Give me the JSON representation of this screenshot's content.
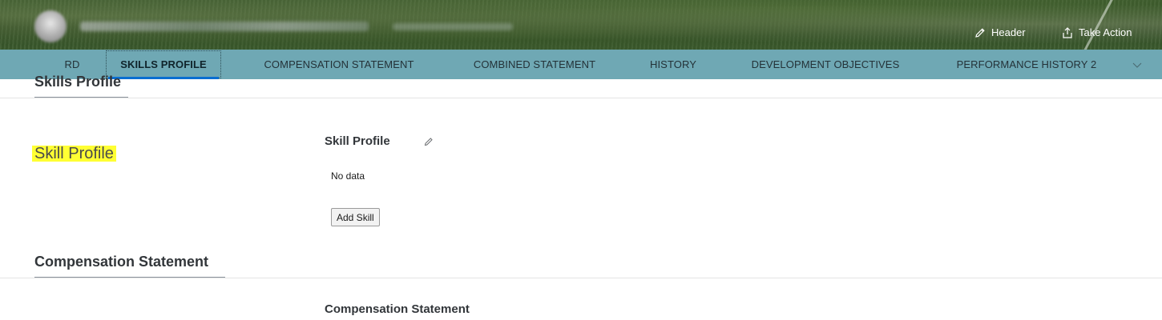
{
  "header": {
    "actions": [
      {
        "label": "Header",
        "icon": "pencil-icon"
      },
      {
        "label": "Take Action",
        "icon": "share-icon"
      }
    ]
  },
  "tabs": {
    "items": [
      {
        "label": "RD"
      },
      {
        "label": "SKILLS PROFILE",
        "active": true
      },
      {
        "label": "COMPENSATION STATEMENT"
      },
      {
        "label": "COMBINED STATEMENT"
      },
      {
        "label": "HISTORY"
      },
      {
        "label": "DEVELOPMENT OBJECTIVES"
      },
      {
        "label": "PERFORMANCE HISTORY 2"
      }
    ],
    "overflow_icon": "chevron-down-icon"
  },
  "skills_section": {
    "title": "Skills Profile",
    "highlight_label": "Skill Profile",
    "block_title": "Skill Profile",
    "empty_text": "No data",
    "add_button": "Add Skill"
  },
  "compensation_section": {
    "title": "Compensation Statement",
    "block_title": "Compensation Statement"
  },
  "colors": {
    "tab_bar": "#6fa8b4",
    "active_underline": "#0a6ed1",
    "highlight": "#ffff33"
  }
}
